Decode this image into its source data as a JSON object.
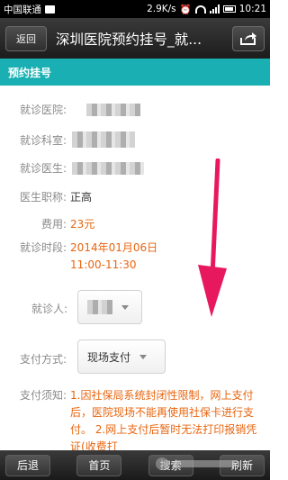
{
  "status_bar": {
    "carrier": "中国联通",
    "speed": "2.9K/s",
    "time": "10:21"
  },
  "title_bar": {
    "back_label": "返回",
    "title": "深圳医院预约挂号_就..."
  },
  "section": {
    "title": "预约挂号"
  },
  "form": {
    "hospital_label": "就诊医院:",
    "department_label": "就诊科室:",
    "doctor_label": "就诊医生:",
    "title_label": "医生职称:",
    "title_value": "正高",
    "fee_label": "费用:",
    "fee_value": "23元",
    "time_label": "就诊时段:",
    "time_date": "2014年01月06日",
    "time_slot": "11:00-11:30",
    "patient_label": "就诊人:",
    "payment_label": "支付方式:",
    "payment_value": "现场支付",
    "notice_label": "支付须知:",
    "notice_text": "1.因社保局系统封闭性限制，网上支付后，医院现场不能再使用社保卡进行支付。 2.网上支付后暂时无法打印报销凭证(收费打"
  },
  "bottom_bar": {
    "back": "后退",
    "home": "首页",
    "search": "搜索",
    "refresh": "刷新"
  },
  "colors": {
    "teal": "#1ab0b3",
    "orange": "#e8650f",
    "arrow": "#e8185f"
  }
}
